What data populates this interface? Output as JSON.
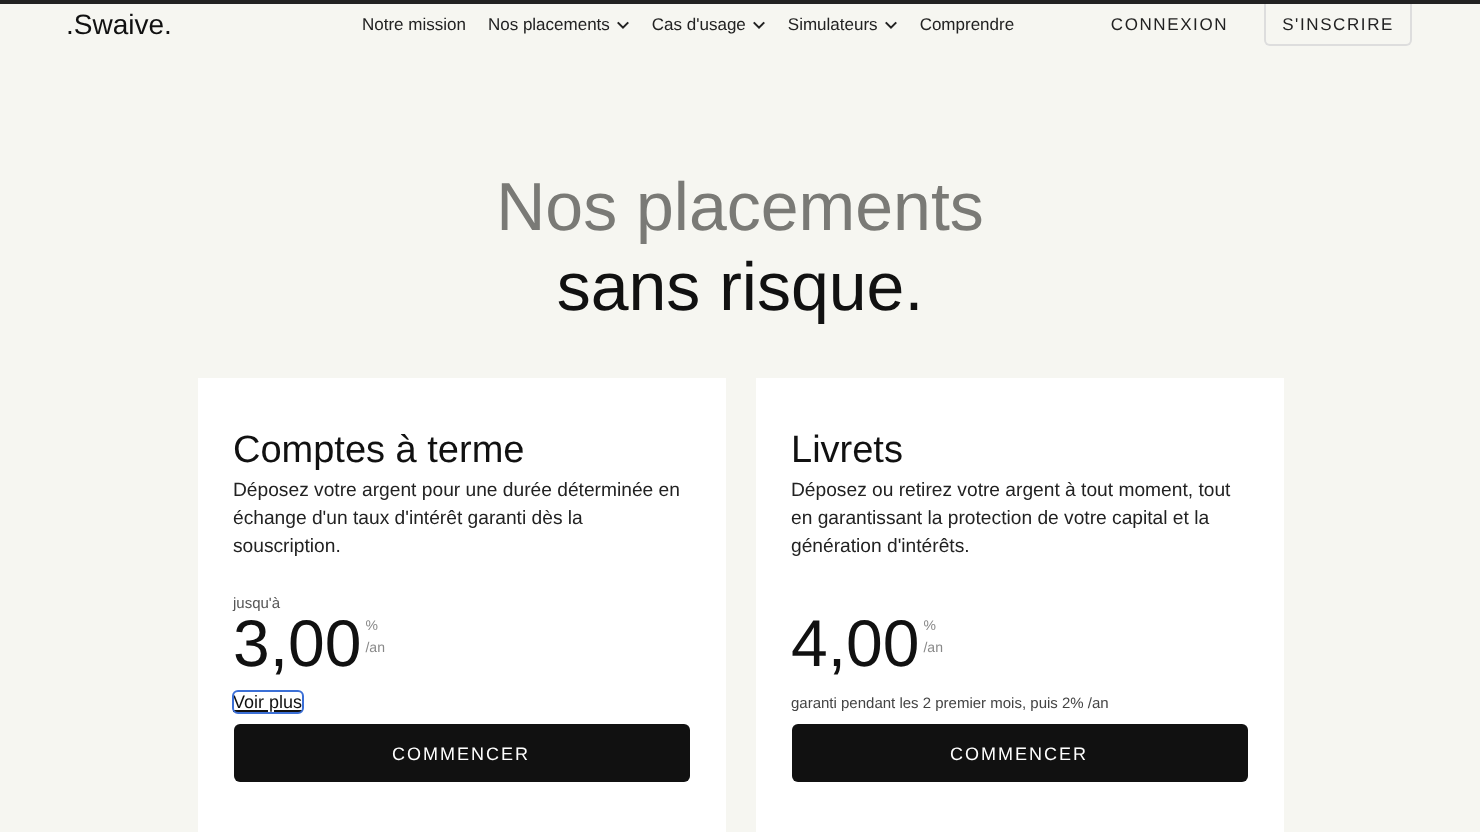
{
  "header": {
    "logo": ".Swaive.",
    "nav": [
      {
        "label": "Notre mission",
        "dropdown": false
      },
      {
        "label": "Nos placements",
        "dropdown": true
      },
      {
        "label": "Cas d'usage",
        "dropdown": true
      },
      {
        "label": "Simulateurs",
        "dropdown": true
      },
      {
        "label": "Comprendre",
        "dropdown": false
      }
    ],
    "login": "CONNEXION",
    "signup": "S'INSCRIRE"
  },
  "hero": {
    "line_1": "Nos placements",
    "line_2": "sans risque."
  },
  "cards": [
    {
      "title": "Comptes à terme",
      "description": "Déposez votre argent pour une durée déterminée en échange d'un taux d'intérêt garanti dès la souscription.",
      "prefix": "jusqu'à",
      "rate": "3,00",
      "unit_top": "%",
      "unit_bottom": "/an",
      "kind": "link",
      "footer": "Voir plus",
      "button": "COMMENCER"
    },
    {
      "title": "Livrets",
      "description": "Déposez ou retirez votre argent à tout moment, tout en garantissant la protection de votre capital et la génération d'intérêts.",
      "rate": "4,00",
      "unit_top": "%",
      "unit_bottom": "/an",
      "kind": "note",
      "footer": "garanti pendant les 2 premier mois, puis 2% /an",
      "button": "COMMENCER"
    }
  ]
}
